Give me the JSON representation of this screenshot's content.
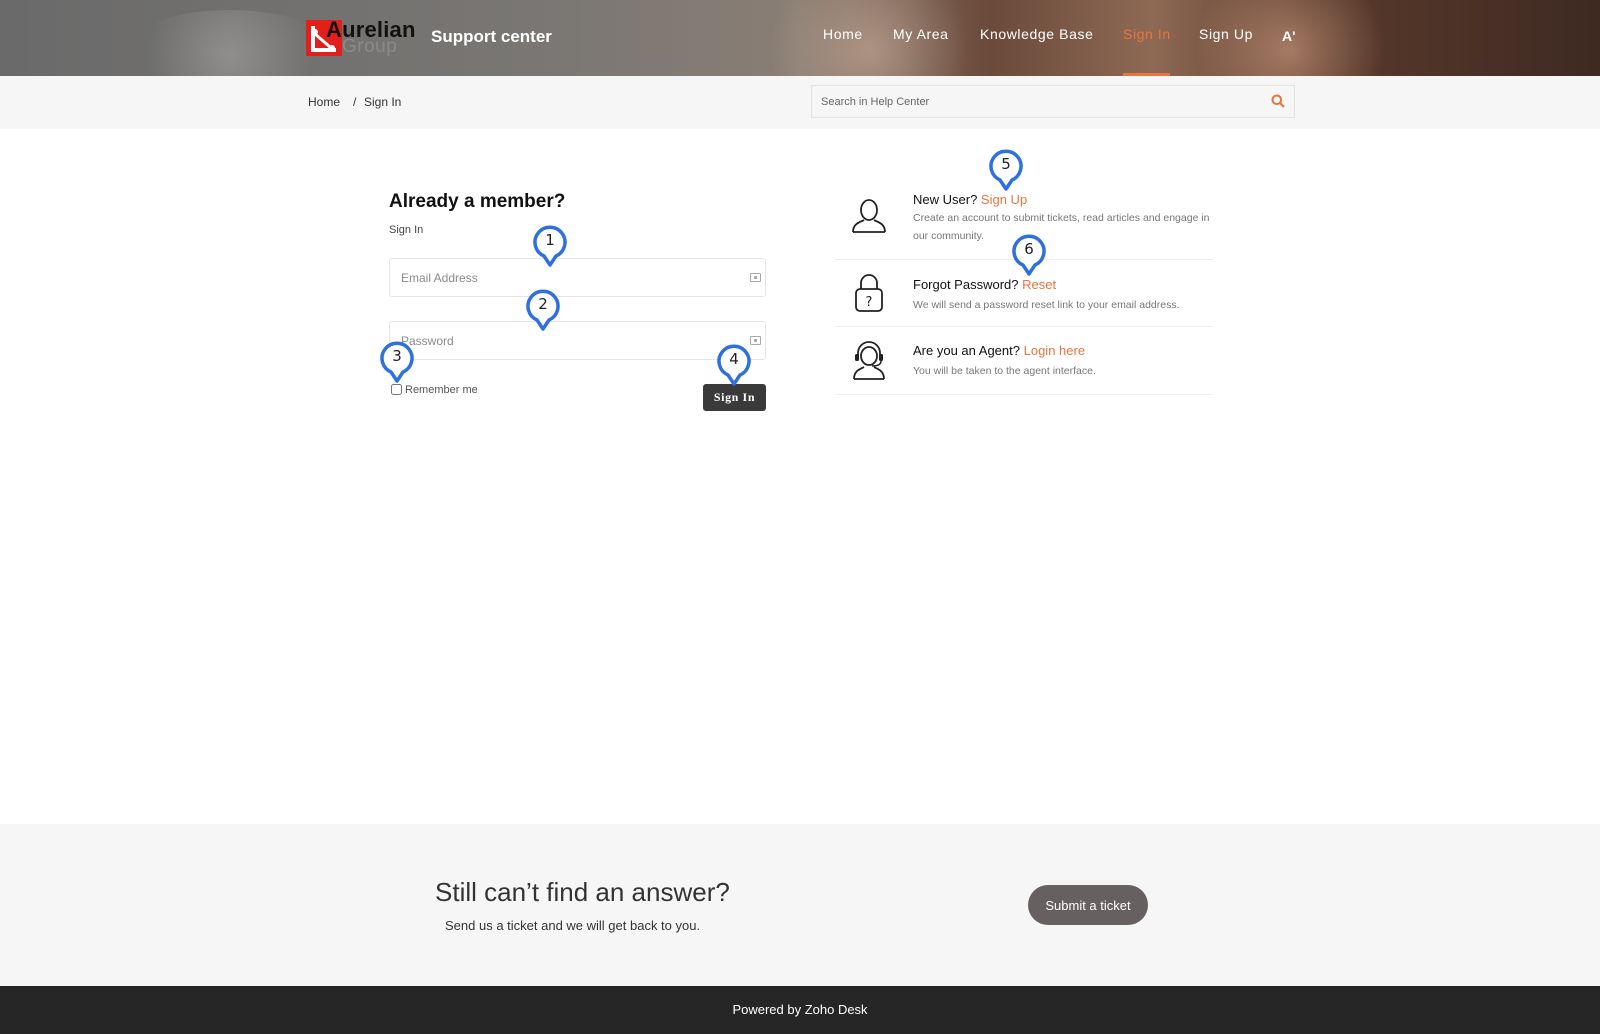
{
  "header": {
    "logo_line1": "Aurelian",
    "logo_line2": "Group",
    "site_title": "Support center",
    "nav": [
      "Home",
      "My Area",
      "Knowledge Base",
      "Sign In",
      "Sign Up"
    ],
    "active_nav": "Sign In",
    "font_toggle": "A'"
  },
  "breadcrumb": {
    "home": "Home",
    "separator": "/",
    "current": "Sign In"
  },
  "search": {
    "placeholder": "Search in Help Center"
  },
  "signin": {
    "heading": "Already a member?",
    "subheading": "Sign In",
    "email_placeholder": "Email Address",
    "password_placeholder": "Password",
    "remember_label": "Remember me",
    "button": "Sign In"
  },
  "options": [
    {
      "prefix": "New User?",
      "link": "Sign Up",
      "desc": "Create an account to submit tickets, read articles and engage in our community.",
      "icon": "user-icon"
    },
    {
      "prefix": "Forgot Password?",
      "link": "Reset",
      "desc": "We will send a password reset link to your email address.",
      "icon": "lock-question-icon"
    },
    {
      "prefix": "Are you an Agent?",
      "link": "Login here",
      "desc": "You will be taken to the agent interface.",
      "icon": "headset-agent-icon"
    }
  ],
  "markers": [
    "1",
    "2",
    "3",
    "4",
    "5",
    "6"
  ],
  "cta": {
    "title": "Still can’t find an answer?",
    "subtitle": "Send us a ticket and we will get back to you.",
    "button": "Submit a ticket"
  },
  "footer": {
    "text": "Powered by Zoho Desk"
  },
  "colors": {
    "accent": "#e8753f",
    "marker": "#2f6fde",
    "button_dark": "#3a3a3a",
    "logo_red": "#e1201b"
  }
}
